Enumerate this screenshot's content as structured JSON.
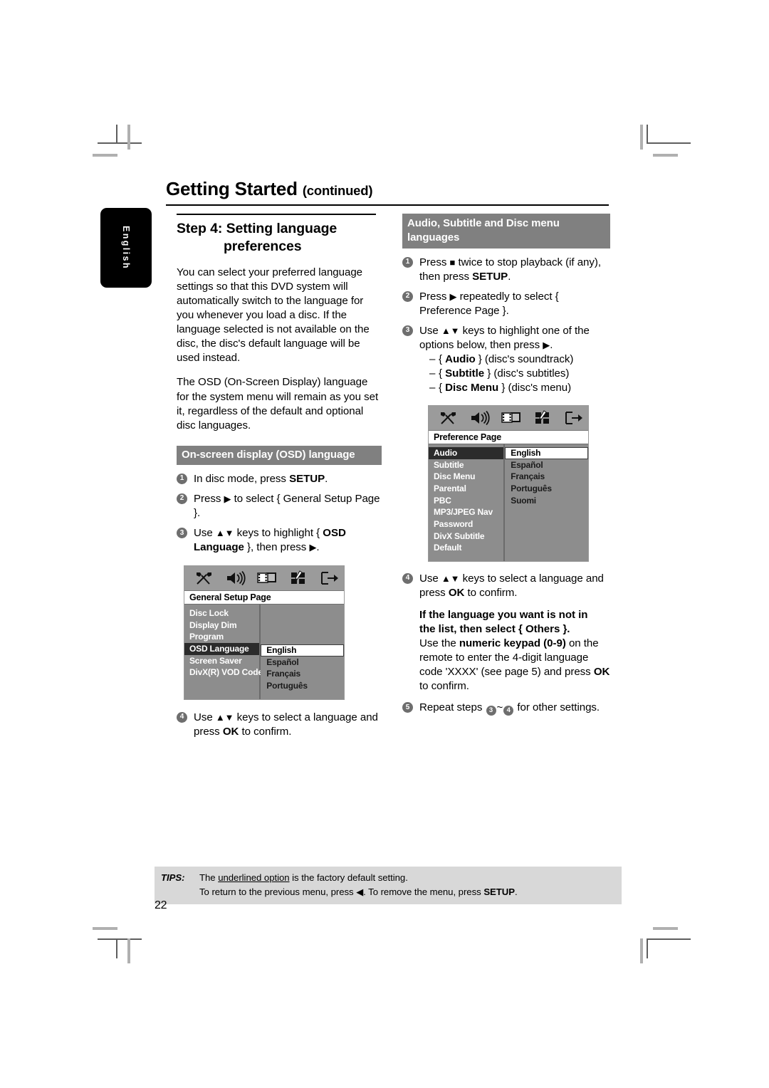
{
  "page": {
    "title": "Getting Started",
    "title_suffix": "(continued)",
    "side_tab": "English",
    "page_number": "22"
  },
  "left_column": {
    "step_heading_line1": "Step 4: Setting language",
    "step_heading_line2": "preferences",
    "paragraphs": [
      "You can select your preferred language settings so that this DVD system will automatically switch to the language for you whenever you load a disc.  If the language selected is not available on the disc, the disc's default language will be used instead.",
      "The OSD (On-Screen Display) language for the system menu will remain as you set it, regardless of the default and optional disc languages."
    ],
    "section_heading": "On-screen display (OSD) language",
    "steps": [
      {
        "num": "1",
        "text": "In disc mode, press ",
        "bold": "SETUP",
        "tail": "."
      },
      {
        "num": "2",
        "text": "Press ",
        "glyph": "▶",
        "tail": " to select { General Setup Page }."
      },
      {
        "num": "3",
        "text": "Use ",
        "glyph": "▲▼",
        "mid": " keys to highlight { ",
        "bold": "OSD Language",
        "tail": " }, then press "
      },
      {
        "num": "4",
        "text": "Use ",
        "glyph": "▲▼",
        "mid": " keys to select a language and press ",
        "bold": "OK",
        "tail": " to confirm."
      }
    ],
    "screenshot": {
      "title": "General Setup Page",
      "icons": [
        "tools-icon",
        "speaker-icon",
        "video-icon",
        "preference-icon",
        "exit-icon"
      ],
      "menu_items": [
        "Disc Lock",
        "Display Dim",
        "Program",
        "OSD Language",
        "Screen Saver",
        "DivX(R) VOD Code"
      ],
      "selected_menu_item": "OSD Language",
      "values": [
        "English",
        "Español",
        "Français",
        "Português"
      ],
      "selected_value": "English"
    }
  },
  "right_column": {
    "section_heading_line1": "Audio, Subtitle and Disc menu",
    "section_heading_line2": "languages",
    "steps": [
      {
        "num": "1",
        "text": "Press ",
        "glyph": "■",
        "mid": " twice to stop playback (if any), then press ",
        "bold": "SETUP",
        "tail": "."
      },
      {
        "num": "2",
        "text": "Press ",
        "glyph": "▶",
        "tail": " repeatedly to select { Preference Page }."
      },
      {
        "num": "3",
        "text": "Use ",
        "glyph": "▲▼",
        "mid": " keys to highlight one of the options below, then press ",
        "tail": "."
      },
      {
        "num": "4",
        "text": "Use ",
        "glyph": "▲▼",
        "mid": " keys to select a language and press ",
        "bold": "OK",
        "tail": " to confirm."
      },
      {
        "num": "5",
        "text": "Repeat steps ",
        "tail": " for other settings."
      }
    ],
    "step3_options": [
      {
        "bold": "Audio",
        "tail": " } (disc's soundtrack)"
      },
      {
        "bold": "Subtitle",
        "tail": " } (disc's subtitles)"
      },
      {
        "bold": "Disc Menu",
        "tail": " } (disc's menu)"
      }
    ],
    "note": {
      "line1": "If the language you want is not in",
      "line2_bold": "the list, then select",
      "line2_braced": "{ Others }.",
      "body_a": "Use the ",
      "body_bold": "numeric keypad (0-9)",
      "body_b": " on the remote to enter the 4-digit language code 'XXXX' (see page 5) and press ",
      "body_bold2": "OK",
      "body_c": " to confirm."
    },
    "repeat_from": "3",
    "repeat_to": "4",
    "screenshot": {
      "title": "Preference Page",
      "icons": [
        "tools-icon",
        "speaker-icon",
        "video-icon",
        "preference-icon",
        "exit-icon"
      ],
      "menu_items": [
        "Audio",
        "Subtitle",
        "Disc Menu",
        "Parental",
        "PBC",
        "MP3/JPEG Nav",
        "Password",
        "DivX Subtitle",
        "Default"
      ],
      "selected_menu_item": "Audio",
      "values": [
        "English",
        "Español",
        "Français",
        "Português",
        "Suomi"
      ],
      "selected_value": "English"
    }
  },
  "tips": {
    "label": "TIPS:",
    "line1_a": "The ",
    "line1_underlined": "underlined option",
    "line1_b": " is the factory default setting.",
    "line2_a": "To return to the previous menu, press ",
    "line2_glyph": "◀",
    "line2_b": ". To remove the menu, press ",
    "line2_bold": "SETUP",
    "line2_c": "."
  },
  "colors": {
    "gray_heading_bg": "#808080",
    "tips_bg": "#d8d8d8",
    "badge_bg": "#6e6e6e",
    "tv_bg": "#8d8d8d",
    "tv_selected": "#2b2b2b"
  }
}
